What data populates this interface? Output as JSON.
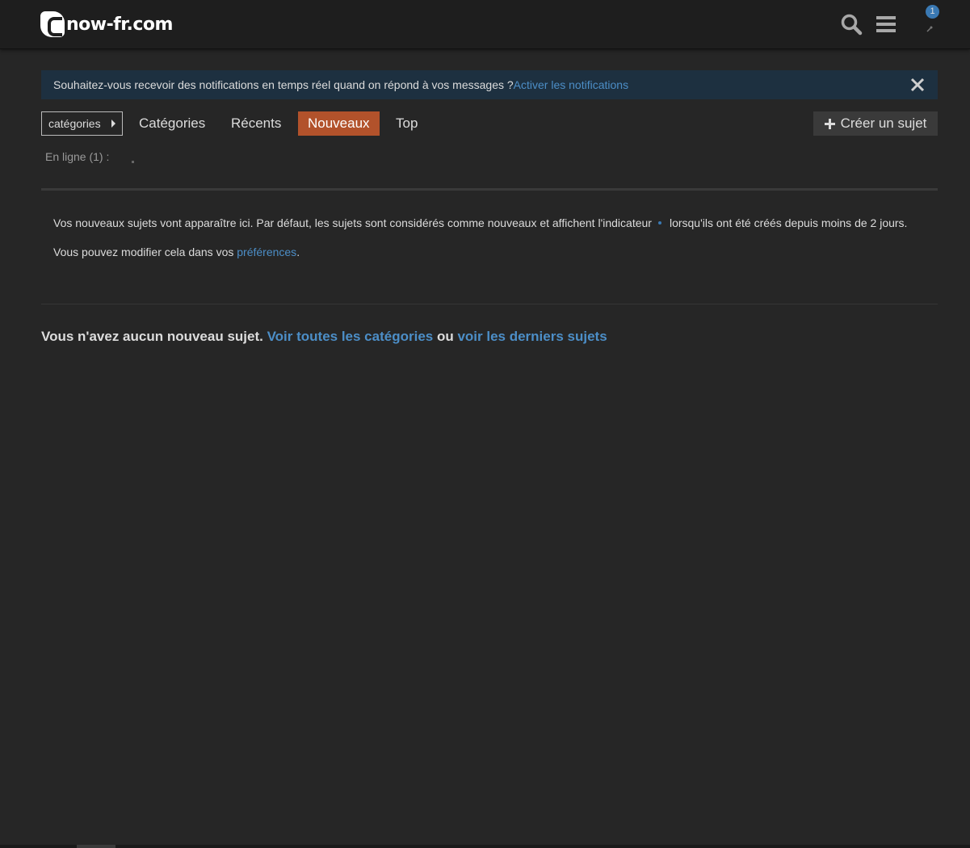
{
  "header": {
    "logo_text": "now-fr.com",
    "notification_count": "1"
  },
  "banner": {
    "message": "Souhaitez-vous recevoir des notifications en temps réel quand on répond à vos messages ? ",
    "link": "Activer les notifications"
  },
  "nav": {
    "categories_dropdown": "catégories",
    "items": [
      "Catégories",
      "Récents",
      "Nouveaux",
      "Top"
    ],
    "active": "Nouveaux",
    "create_button": "Créer un sujet"
  },
  "online": {
    "label": "En ligne (1) :"
  },
  "education": {
    "line1_before": "Vos nouveaux sujets vont apparaître ici. Par défaut, les sujets sont considérés comme nouveaux et affichent l'indicateur",
    "line1_after": "lorsqu'ils ont été créés depuis moins de 2 jours.",
    "line2_before": "Vous pouvez modifier cela dans vos ",
    "line2_link": "préférences",
    "line2_after": "."
  },
  "footer": {
    "message": "Vous n'avez aucun nouveau sujet. ",
    "link_all_categories": "Voir toutes les catégories",
    "conjunction": " ou ",
    "link_latest": "voir les derniers sujets"
  },
  "colors": {
    "background": "#262626",
    "header": "#1e1e1e",
    "accent_active": "#b2522b",
    "link": "#4c8ec7",
    "banner": "#1d3040"
  }
}
